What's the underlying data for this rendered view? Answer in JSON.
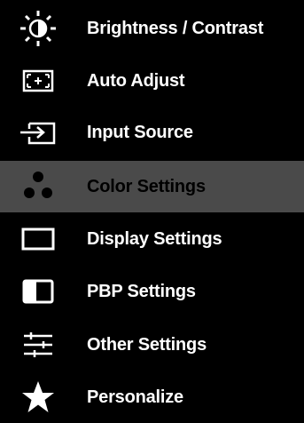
{
  "menu": {
    "items": [
      {
        "label": "Brightness / Contrast",
        "icon": "brightness-icon"
      },
      {
        "label": "Auto Adjust",
        "icon": "auto-adjust-icon"
      },
      {
        "label": "Input Source",
        "icon": "input-source-icon"
      },
      {
        "label": "Color Settings",
        "icon": "color-settings-icon",
        "selected": true
      },
      {
        "label": "Display Settings",
        "icon": "display-settings-icon"
      },
      {
        "label": "PBP Settings",
        "icon": "pbp-settings-icon"
      },
      {
        "label": "Other Settings",
        "icon": "other-settings-icon"
      },
      {
        "label": "Personalize",
        "icon": "personalize-icon"
      }
    ]
  },
  "colors": {
    "background": "#000000",
    "text": "#ffffff",
    "selected_background": "#4a4a4a",
    "selected_text": "#000000"
  }
}
